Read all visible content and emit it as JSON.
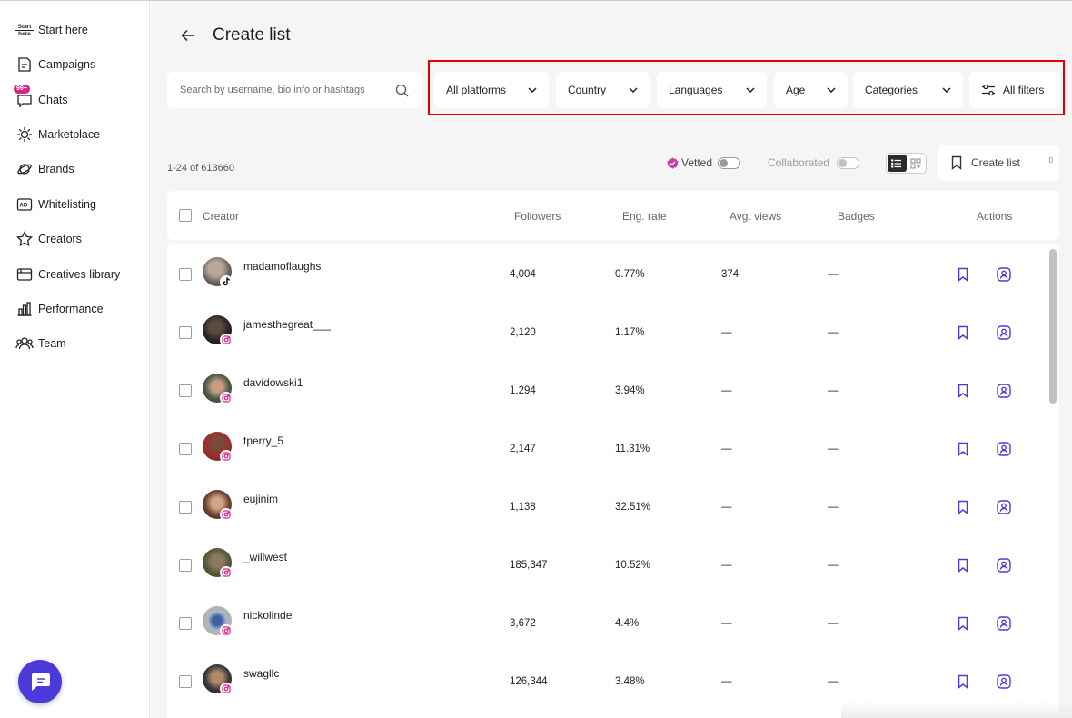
{
  "sidebar": {
    "start_icon_text": [
      "Start",
      "here"
    ],
    "items": [
      {
        "label": "Start here",
        "icon": "start-here-icon"
      },
      {
        "label": "Campaigns",
        "icon": "campaigns-icon"
      },
      {
        "label": "Chats",
        "icon": "chats-icon",
        "badge": "99+"
      },
      {
        "label": "Marketplace",
        "icon": "marketplace-icon"
      },
      {
        "label": "Brands",
        "icon": "brands-icon"
      },
      {
        "label": "Whitelisting",
        "icon": "whitelisting-icon"
      },
      {
        "label": "Creators",
        "icon": "star-icon"
      },
      {
        "label": "Creatives library",
        "icon": "creatives-library-icon"
      },
      {
        "label": "Performance",
        "icon": "bar-chart-icon"
      },
      {
        "label": "Team",
        "icon": "team-icon"
      }
    ]
  },
  "header": {
    "title": "Create list"
  },
  "search": {
    "placeholder": "Search by username, bio info or hashtags"
  },
  "filters": [
    "All platforms",
    "Country",
    "Languages",
    "Age",
    "Categories"
  ],
  "all_filters_label": "All filters",
  "toolbar": {
    "results_count": "1-24 of 613660",
    "vetted_label": "Vetted",
    "collaborated_label": "Collaborated",
    "create_list_label": "Create list",
    "create_list_count": "0"
  },
  "table": {
    "columns": [
      "Creator",
      "Followers",
      "Eng. rate",
      "Avg. views",
      "Badges",
      "Actions"
    ],
    "rows": [
      {
        "username": "madamoflaughs",
        "platform": "tiktok",
        "followers": "4,004",
        "eng_rate": "0.77%",
        "avg_views": "374",
        "badges": "—"
      },
      {
        "username": "jamesthegreat___",
        "platform": "instagram",
        "followers": "2,120",
        "eng_rate": "1.17%",
        "avg_views": "—",
        "badges": "—"
      },
      {
        "username": "davidowski1",
        "platform": "instagram",
        "followers": "1,294",
        "eng_rate": "3.94%",
        "avg_views": "—",
        "badges": "—"
      },
      {
        "username": "tperry_5",
        "platform": "instagram",
        "followers": "2,147",
        "eng_rate": "11.31%",
        "avg_views": "—",
        "badges": "—"
      },
      {
        "username": "eujinim",
        "platform": "instagram",
        "followers": "1,138",
        "eng_rate": "32.51%",
        "avg_views": "—",
        "badges": "—"
      },
      {
        "username": "_willwest",
        "platform": "instagram",
        "followers": "185,347",
        "eng_rate": "10.52%",
        "avg_views": "—",
        "badges": "—"
      },
      {
        "username": "nickolinde",
        "platform": "instagram",
        "followers": "3,672",
        "eng_rate": "4.4%",
        "avg_views": "—",
        "badges": "—"
      },
      {
        "username": "swagllc",
        "platform": "instagram",
        "followers": "126,344",
        "eng_rate": "3.48%",
        "avg_views": "—",
        "badges": "—"
      }
    ]
  },
  "colors": {
    "accent": "#4b3ad9",
    "highlight_box": "#e00000",
    "instagram": "#d6228a",
    "badge": "#d6228a"
  }
}
